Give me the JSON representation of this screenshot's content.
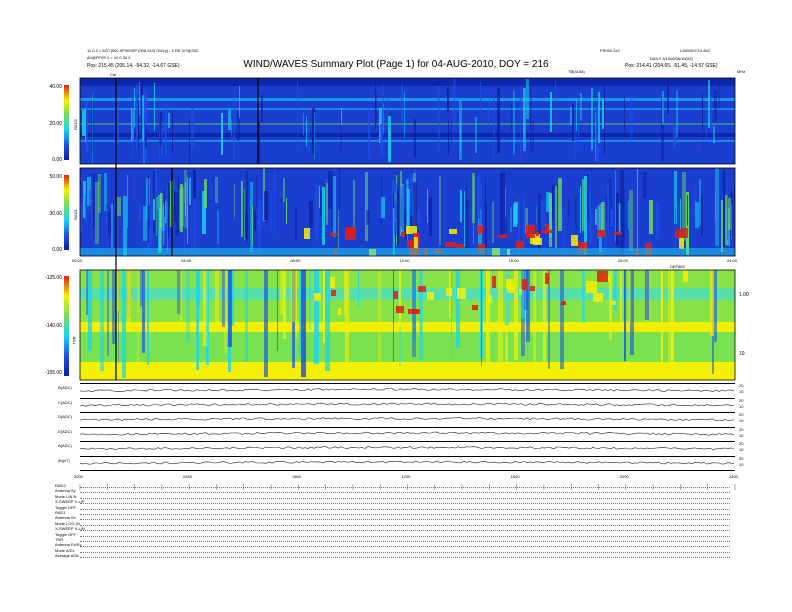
{
  "header": {
    "left_line1": "11 0.2 = 8C0 [000 SP400SP (008 010) 0011y] - 2 RE 0/7@25C",
    "left_line2": "A0@FP0S 2 = 10 0 30 0",
    "left_line3": "Pos:   215.45 (205.14, -54.32, -14.67 GSE)",
    "cal_label": "Cal",
    "right_top_a": "FR030 2x3",
    "right_top_b": "L350/007/14 8x2",
    "right_line2": "DAILY 3/10x0/08/10(02)",
    "right_line3": "Pos:   214.41 (204.65, -51.45, -14.57 GSE)",
    "tb_label": "TB(4158)",
    "mhz": "MHz"
  },
  "title": "WIND/WAVES Summary Plot (Page 1) for 04-AUG-2010, DOY = 216",
  "colors": {
    "deep_blue": "#0a1f9e",
    "blue": "#1e50e8",
    "cyan": "#19d6f0",
    "green": "#6ee05a",
    "yellow": "#f4f000",
    "red": "#e01e12"
  },
  "chart_data": [
    {
      "type": "heatmap",
      "name": "RAD2",
      "ylabel": "RAD2",
      "y_ticks": [
        "40.00",
        "20.00",
        "0.00"
      ],
      "xlim": [
        0,
        24
      ]
    },
    {
      "type": "heatmap",
      "name": "RAD1",
      "ylabel": "RAD1",
      "y_ticks": [
        "50.00",
        "30.00",
        "0.00"
      ],
      "x_ticks": [
        "00:00",
        "04:00",
        "08:00",
        "12:00",
        "16:00",
        "20:00",
        "24:00"
      ],
      "xlim": [
        0,
        24
      ],
      "top_right_label": "DEF8B2"
    },
    {
      "type": "heatmap",
      "name": "TNR",
      "ylabel": "TNR",
      "y_ticks": [
        "-125.00",
        "-140.00",
        "-155.00"
      ],
      "right_ticks": [
        "1.00",
        "10"
      ],
      "xlim": [
        0,
        24
      ]
    },
    {
      "type": "line",
      "name": "housekeeping traces",
      "series": [
        {
          "name": "B(ADC)",
          "right_ticks": [
            "20",
            "10"
          ]
        },
        {
          "name": "C(ADC)",
          "right_ticks": [
            "20",
            "10"
          ]
        },
        {
          "name": "D(ADC)",
          "right_ticks": [
            "20",
            "10"
          ]
        },
        {
          "name": "E(ADC)",
          "right_ticks": [
            "20",
            "10"
          ]
        },
        {
          "name": "A(ADC)",
          "right_ticks": [
            "20",
            "10"
          ]
        },
        {
          "name": "|B|(nT)",
          "right_ticks": [
            "20",
            "10"
          ]
        }
      ],
      "x_ticks": [
        "0000",
        "0400",
        "0800",
        "1200",
        "1600",
        "2000",
        "2400"
      ],
      "xlim": [
        0,
        24
      ]
    }
  ],
  "footer_labels": [
    "RAD2",
    "Antenna       Sy",
    "Mode     LIN N",
    "X-SWEEP  X-LIP",
    "Toggle      OFF",
    "RAD1",
    "Antenna       Sx",
    "Mode   LOG (N",
    "X-SWEEP  X-LIN",
    "Toggle      OFF",
    "TNR",
    "Antenna   Ex/Ey",
    "Mode      A/DL",
    "Average    A/DL"
  ]
}
